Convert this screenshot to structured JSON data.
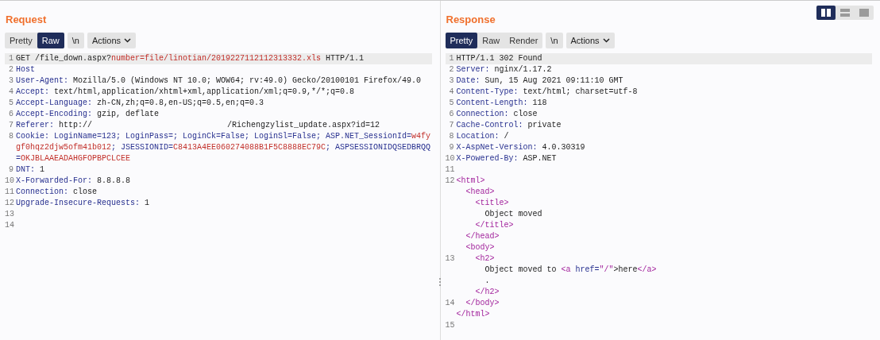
{
  "layout_toggle": [
    {
      "selected": true,
      "kind": "split"
    },
    {
      "selected": false,
      "kind": "stacked"
    },
    {
      "selected": false,
      "kind": "single"
    }
  ],
  "panels": [
    {
      "title": "Request",
      "tabs": [
        {
          "label": "Pretty",
          "selected": false
        },
        {
          "label": "Raw",
          "selected": true
        }
      ],
      "newline_toggle": "\\n",
      "actions": "Actions",
      "lines": [
        {
          "number": "1",
          "highlighted": true,
          "segments": [
            {
              "text": "GET /file_down.aspx?",
              "kind": "plain"
            },
            {
              "text": "number=file/linotian/2019227112112313332.xls",
              "kind": "param"
            },
            {
              "text": " HTTP/1.1",
              "kind": "plain"
            }
          ]
        },
        {
          "number": "2",
          "highlighted": false,
          "segments": [
            {
              "text": "Host",
              "kind": "key"
            }
          ]
        },
        {
          "number": "3",
          "highlighted": false,
          "segments": [
            {
              "text": "User-Agent:",
              "kind": "key"
            },
            {
              "text": " Mozilla/5.0 (Windows NT 10.0; WOW64; rv:49.0) Gecko/20100101 Firefox/49.0",
              "kind": "plain"
            }
          ]
        },
        {
          "number": "4",
          "highlighted": false,
          "segments": [
            {
              "text": "Accept:",
              "kind": "key"
            },
            {
              "text": " text/html,application/xhtml+xml,application/xml;q=0.9,*/*;q=0.8",
              "kind": "plain"
            }
          ]
        },
        {
          "number": "5",
          "highlighted": false,
          "segments": [
            {
              "text": "Accept-Language:",
              "kind": "key"
            },
            {
              "text": " zh-CN,zh;q=0.8,en-US;q=0.5,en;q=0.3",
              "kind": "plain"
            }
          ]
        },
        {
          "number": "6",
          "highlighted": false,
          "segments": [
            {
              "text": "Accept-Encoding:",
              "kind": "key"
            },
            {
              "text": " gzip, deflate",
              "kind": "plain"
            }
          ]
        },
        {
          "number": "7",
          "highlighted": false,
          "segments": [
            {
              "text": "Referer:",
              "kind": "key"
            },
            {
              "text": " http://",
              "kind": "plain"
            },
            {
              "text": "/Richengzylist_update.aspx?id=12",
              "kind": "plain",
              "gap": true
            }
          ]
        },
        {
          "number": "8",
          "highlighted": false,
          "segments": [
            {
              "text": "Cookie:",
              "kind": "key"
            },
            {
              "text": " LoginName=123; LoginPass=; LoginCk=False; LoginSl=False; ASP.NET_SessionId=",
              "kind": "key"
            },
            {
              "text": "w4fygf0hqz2djw5ofm41b012",
              "kind": "param"
            },
            {
              "text": "; JSESSIONID=",
              "kind": "key"
            },
            {
              "text": "C8413A4EE060274088B1F5C8888EC79C",
              "kind": "param"
            },
            {
              "text": "; ASPSESSIONIDQSEDBRQQ=",
              "kind": "key"
            },
            {
              "text": "OKJBLAAEADAHGFOPBPCLCEE",
              "kind": "param"
            }
          ]
        },
        {
          "number": "9",
          "highlighted": false,
          "segments": [
            {
              "text": "DNT:",
              "kind": "key"
            },
            {
              "text": " 1",
              "kind": "plain"
            }
          ]
        },
        {
          "number": "10",
          "highlighted": false,
          "segments": [
            {
              "text": "X-Forwarded-For:",
              "kind": "key"
            },
            {
              "text": " 8.8.8.8",
              "kind": "plain"
            }
          ]
        },
        {
          "number": "11",
          "highlighted": false,
          "segments": [
            {
              "text": "Connection:",
              "kind": "key"
            },
            {
              "text": " close",
              "kind": "plain"
            }
          ]
        },
        {
          "number": "12",
          "highlighted": false,
          "segments": [
            {
              "text": "Upgrade-Insecure-Requests:",
              "kind": "key"
            },
            {
              "text": " 1",
              "kind": "plain"
            }
          ]
        },
        {
          "number": "13",
          "highlighted": false
        },
        {
          "number": "14",
          "highlighted": false
        }
      ]
    },
    {
      "title": "Response",
      "tabs": [
        {
          "label": "Pretty",
          "selected": true
        },
        {
          "label": "Raw",
          "selected": false
        },
        {
          "label": "Render",
          "selected": false
        }
      ],
      "newline_toggle": "\\n",
      "actions": "Actions",
      "lines": [
        {
          "number": "1",
          "highlighted": true,
          "segments": [
            {
              "text": "HTTP/1.1 302 Found",
              "kind": "plain"
            }
          ]
        },
        {
          "number": "2",
          "highlighted": false,
          "segments": [
            {
              "text": "Server:",
              "kind": "key"
            },
            {
              "text": " nginx/1.17.2",
              "kind": "plain"
            }
          ]
        },
        {
          "number": "3",
          "highlighted": false,
          "segments": [
            {
              "text": "Date:",
              "kind": "key"
            },
            {
              "text": " Sun, 15 Aug 2021 09:11:10 GMT",
              "kind": "plain"
            }
          ]
        },
        {
          "number": "4",
          "highlighted": false,
          "segments": [
            {
              "text": "Content-Type:",
              "kind": "key"
            },
            {
              "text": " text/html; charset=utf-8",
              "kind": "plain"
            }
          ]
        },
        {
          "number": "5",
          "highlighted": false,
          "segments": [
            {
              "text": "Content-Length:",
              "kind": "key"
            },
            {
              "text": " 118",
              "kind": "plain"
            }
          ]
        },
        {
          "number": "6",
          "highlighted": false,
          "segments": [
            {
              "text": "Connection:",
              "kind": "key"
            },
            {
              "text": " close",
              "kind": "plain"
            }
          ]
        },
        {
          "number": "7",
          "highlighted": false,
          "segments": [
            {
              "text": "Cache-Control:",
              "kind": "key"
            },
            {
              "text": " private",
              "kind": "plain"
            }
          ]
        },
        {
          "number": "8",
          "highlighted": false,
          "segments": [
            {
              "text": "Location:",
              "kind": "key"
            },
            {
              "text": " /",
              "kind": "plain"
            }
          ]
        },
        {
          "number": "9",
          "highlighted": false,
          "segments": [
            {
              "text": "X-AspNet-Version:",
              "kind": "key"
            },
            {
              "text": " 4.0.30319",
              "kind": "plain"
            }
          ]
        },
        {
          "number": "10",
          "highlighted": false,
          "segments": [
            {
              "text": "X-Powered-By:",
              "kind": "key"
            },
            {
              "text": " ASP.NET",
              "kind": "plain"
            }
          ]
        },
        {
          "number": "11",
          "highlighted": false
        },
        {
          "number": "12",
          "highlighted": false,
          "segments": [
            {
              "text": "<html>",
              "kind": "tag"
            }
          ],
          "children": [
            {
              "segments": [
                {
                  "text": "<head>",
                  "kind": "tag"
                }
              ],
              "children": [
                {
                  "segments": [
                    {
                      "text": "<title>",
                      "kind": "tag"
                    }
                  ],
                  "children": [
                    {
                      "segments": [
                        {
                          "text": "Object moved",
                          "kind": "plain"
                        }
                      ]
                    }
                  ]
                },
                {
                  "segments": [
                    {
                      "text": "</title>",
                      "kind": "tag"
                    }
                  ]
                }
              ]
            },
            {
              "segments": [
                {
                  "text": "</head>",
                  "kind": "tag"
                }
              ]
            },
            {
              "segments": [
                {
                  "text": "<body>",
                  "kind": "tag"
                }
              ],
              "children": [
                {
                  "number": "13",
                  "segments": [
                    {
                      "text": "<h2>",
                      "kind": "tag"
                    }
                  ],
                  "children": [
                    {
                      "segments": [
                        {
                          "text": "Object moved to ",
                          "kind": "plain"
                        },
                        {
                          "text": "<a ",
                          "kind": "tag"
                        },
                        {
                          "text": "href=",
                          "kind": "key"
                        },
                        {
                          "text": "\"/\"",
                          "kind": "tag"
                        },
                        {
                          "text": ">here",
                          "kind": "plain"
                        },
                        {
                          "text": "</a>",
                          "kind": "tag"
                        }
                      ]
                    },
                    {
                      "segments": [
                        {
                          "text": ".",
                          "kind": "plain"
                        }
                      ]
                    }
                  ]
                },
                {
                  "segments": [
                    {
                      "text": "</h2>",
                      "kind": "tag"
                    }
                  ]
                }
              ]
            },
            {
              "number": "14",
              "segments": [
                {
                  "text": "</body>",
                  "kind": "tag"
                }
              ]
            }
          ]
        },
        {
          "segments": [
            {
              "text": "</html>",
              "kind": "tag"
            }
          ]
        },
        {
          "number": "15",
          "highlighted": false
        }
      ]
    }
  ]
}
